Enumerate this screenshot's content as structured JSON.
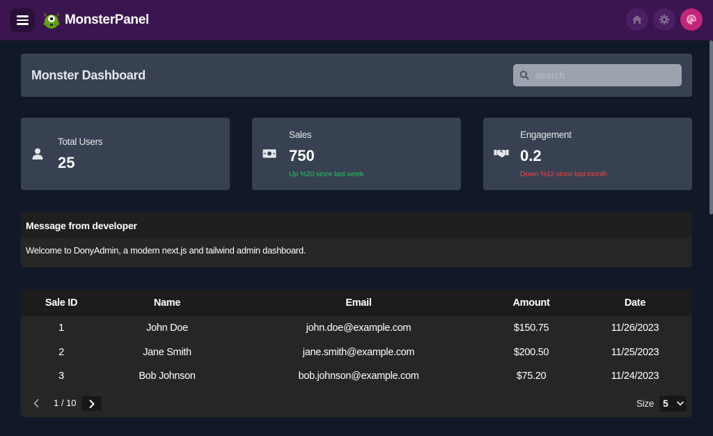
{
  "app": {
    "brand": "MonsterPanel"
  },
  "topbar": {
    "icons": [
      "home-icon",
      "gear-icon",
      "palette-icon"
    ]
  },
  "header": {
    "title": "Monster Dashboard",
    "search_placeholder": "search"
  },
  "stats": [
    {
      "label": "Total Users",
      "value": "25",
      "note": "",
      "icon": "user-icon"
    },
    {
      "label": "Sales",
      "value": "750",
      "note": "Up %20 since last week",
      "note_color": "#22c55e",
      "icon": "money-bill-icon"
    },
    {
      "label": "Engagement",
      "value": "0.2",
      "note": "Down %12 since last month",
      "note_color": "#ef4444",
      "icon": "handshake-icon"
    }
  ],
  "message": {
    "title": "Message from developer",
    "body": "Welcome to DonyAdmin, a modern next.js and tailwind admin dashboard."
  },
  "table": {
    "columns": [
      "Sale ID",
      "Name",
      "Email",
      "Amount",
      "Date"
    ],
    "rows": [
      [
        "1",
        "John Doe",
        "john.doe@example.com",
        "$150.75",
        "11/26/2023"
      ],
      [
        "2",
        "Jane Smith",
        "jane.smith@example.com",
        "$200.50",
        "11/25/2023"
      ],
      [
        "3",
        "Bob Johnson",
        "bob.johnson@example.com",
        "$75.20",
        "11/24/2023"
      ]
    ],
    "page_indicator": "1 / 10",
    "size_label": "Size",
    "size_value": "5"
  },
  "colors": {
    "topbar": "#3b1550",
    "background": "#111827",
    "card": "#374151",
    "accent": "#c0267a",
    "positive": "#22c55e",
    "negative": "#ef4444"
  }
}
